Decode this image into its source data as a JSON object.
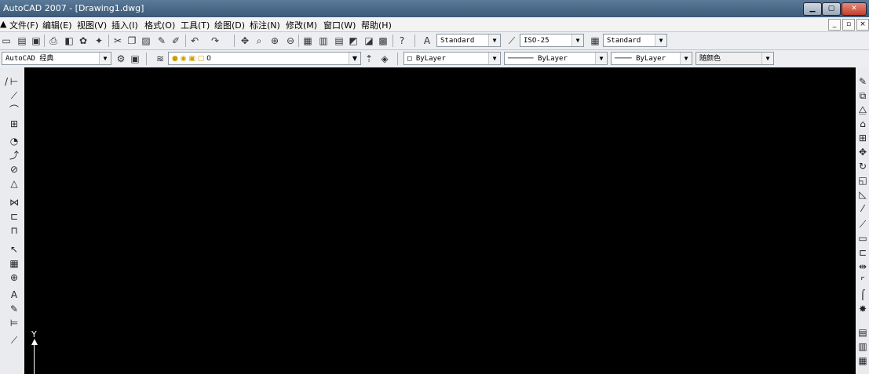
{
  "window": {
    "title": "AutoCAD 2007 - [Drawing1.dwg]"
  },
  "menu": [
    {
      "label": "文件(F)"
    },
    {
      "label": "编辑(E)"
    },
    {
      "label": "视图(V)"
    },
    {
      "label": "插入(I)"
    },
    {
      "label": "格式(O)"
    },
    {
      "label": "工具(T)"
    },
    {
      "label": "绘图(D)"
    },
    {
      "label": "标注(N)"
    },
    {
      "label": "修改(M)"
    },
    {
      "label": "窗口(W)"
    },
    {
      "label": "帮助(H)"
    }
  ],
  "styles": {
    "text_style": "Standard",
    "dim_style": "ISO-25",
    "table_style": "Standard"
  },
  "workspace": "AutoCAD 经典",
  "layer": {
    "current": "0"
  },
  "properties": {
    "color": "ByLayer",
    "linetype": "ByLayer",
    "lineweight": "ByLayer",
    "plot_style": "随颜色"
  },
  "axis": {
    "y_label": "Y"
  },
  "colors": {
    "canvas": "#000000",
    "title_bar": "#3b5a78"
  }
}
